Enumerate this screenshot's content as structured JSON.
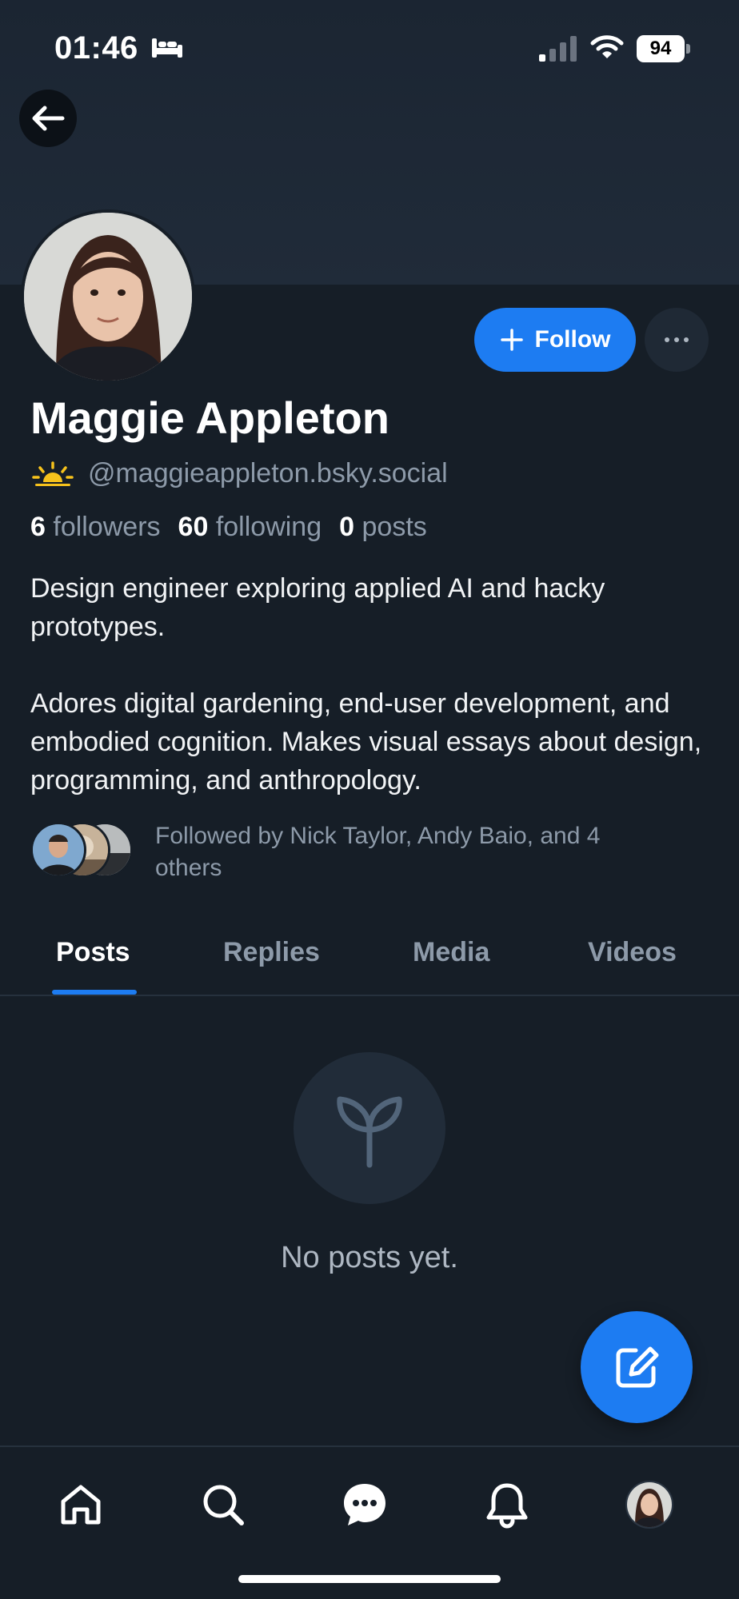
{
  "status_bar": {
    "time": "01:46",
    "battery": "94"
  },
  "profile": {
    "display_name": "Maggie Appleton",
    "handle": "@maggieappleton.bsky.social",
    "stats": {
      "followers_count": "6",
      "followers_label": "followers",
      "following_count": "60",
      "following_label": "following",
      "posts_count": "0",
      "posts_label": "posts"
    },
    "bio": [
      "Design engineer exploring applied AI and hacky prototypes.",
      "Adores digital gardening, end-user development, and embodied cognition. Makes visual essays about design, programming, and anthropology."
    ],
    "followed_by": "Followed by Nick Taylor, Andy Baio, and 4 others"
  },
  "actions": {
    "follow_label": "Follow"
  },
  "tabs": [
    {
      "label": "Posts",
      "active": true
    },
    {
      "label": "Replies",
      "active": false
    },
    {
      "label": "Media",
      "active": false
    },
    {
      "label": "Videos",
      "active": false
    }
  ],
  "empty_state": {
    "message": "No posts yet."
  },
  "nav": [
    {
      "icon": "home-icon"
    },
    {
      "icon": "search-icon"
    },
    {
      "icon": "chat-icon"
    },
    {
      "icon": "bell-icon"
    },
    {
      "icon": "profile-avatar"
    }
  ],
  "colors": {
    "accent": "#1d7cf2",
    "background": "#161e27",
    "muted": "#8d9aa9"
  }
}
